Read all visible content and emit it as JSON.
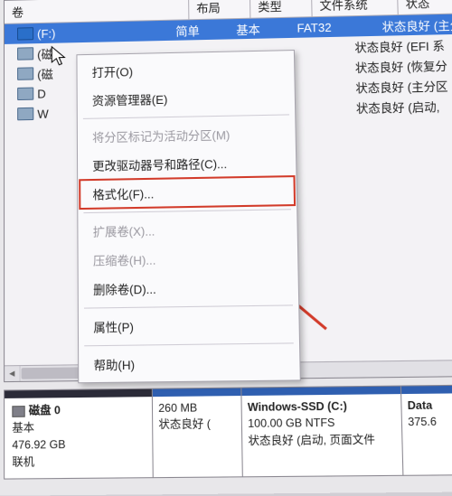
{
  "columns": {
    "volume": "卷",
    "layout": "布局",
    "type": "类型",
    "fs": "文件系统",
    "status": "状态"
  },
  "rows": [
    {
      "vol": "(F:)",
      "layout": "简单",
      "type": "基本",
      "fs": "FAT32",
      "status": "状态良好 (主分区"
    },
    {
      "vol": "(磁",
      "layout": "",
      "type": "",
      "fs": "",
      "status": "状态良好 (EFI 系"
    },
    {
      "vol": "(磁",
      "layout": "",
      "type": "",
      "fs": "",
      "status": "状态良好 (恢复分"
    },
    {
      "vol": "D",
      "layout": "",
      "type": "",
      "fs": "",
      "status": "状态良好 (主分区"
    },
    {
      "vol": "W",
      "layout": "",
      "type": "",
      "fs": "",
      "status": "状态良好 (启动, "
    }
  ],
  "menu": {
    "open": "打开(O)",
    "explorer": "资源管理器(E)",
    "mark_active": "将分区标记为活动分区(M)",
    "change_letter": "更改驱动器号和路径(C)...",
    "format": "格式化(F)...",
    "extend": "扩展卷(X)...",
    "shrink": "压缩卷(H)...",
    "delete": "删除卷(D)...",
    "properties": "属性(P)",
    "help": "帮助(H)"
  },
  "disk": {
    "title": "磁盘 0",
    "kind": "基本",
    "size": "476.92 GB",
    "state": "联机"
  },
  "partitions": [
    {
      "name": "",
      "size": "260 MB",
      "status": "状态良好 ("
    },
    {
      "name": "Windows-SSD  (C:)",
      "size": "100.00 GB NTFS",
      "status": "状态良好 (启动, 页面文件"
    },
    {
      "name": "Data",
      "size": "375.6",
      "status": ""
    }
  ]
}
